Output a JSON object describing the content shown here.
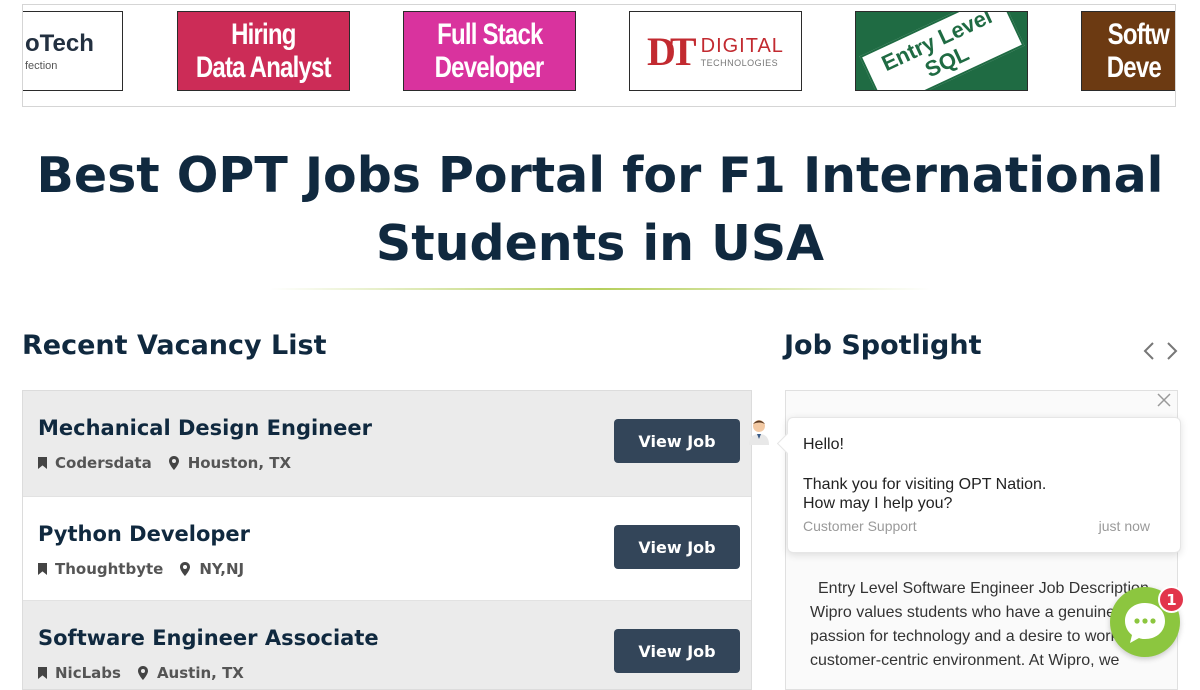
{
  "logos": [
    {
      "line1": "oTech",
      "line2": "fection"
    },
    {
      "line1": "Hiring",
      "line2": "Data Analyst"
    },
    {
      "line1": "Full Stack",
      "line2": "Developer"
    },
    {
      "mark": "DT",
      "line1": "DIGITAL",
      "line2": "TECHNOLOGIES"
    },
    {
      "line1": "Entry Level",
      "line2": "SQL"
    },
    {
      "line1": "Softw",
      "line2": "Deve"
    }
  ],
  "hero": {
    "line1": "Best OPT Jobs Portal for F1 International",
    "line2": "Students in USA"
  },
  "vacancies": {
    "title": "Recent Vacancy List",
    "button_label": "View Job",
    "items": [
      {
        "title": "Mechanical Design Engineer",
        "company": "Codersdata",
        "location": "Houston, TX"
      },
      {
        "title": "Python Developer",
        "company": "Thoughtbyte",
        "location": "NY,NJ"
      },
      {
        "title": "Software Engineer Associate",
        "company": "NicLabs",
        "location": "Austin, TX"
      }
    ]
  },
  "spotlight": {
    "title": "Job Spotlight",
    "text": "Entry Level Software Engineer Job Description Wipro values students who have a genuine passion for technology and a desire to work customer-centric environment. At Wipro, we"
  },
  "chat": {
    "greeting": "Hello!",
    "message_line1": "Thank you for visiting OPT Nation.",
    "message_line2": "How may I help you?",
    "sender": "Customer Support",
    "time": "just now",
    "badge_count": "1"
  },
  "colors": {
    "navy": "#10293f",
    "button": "#334559",
    "chat_green": "#8cc63f",
    "badge_red": "#e2364b",
    "divider_green": "#b5cf5c"
  }
}
